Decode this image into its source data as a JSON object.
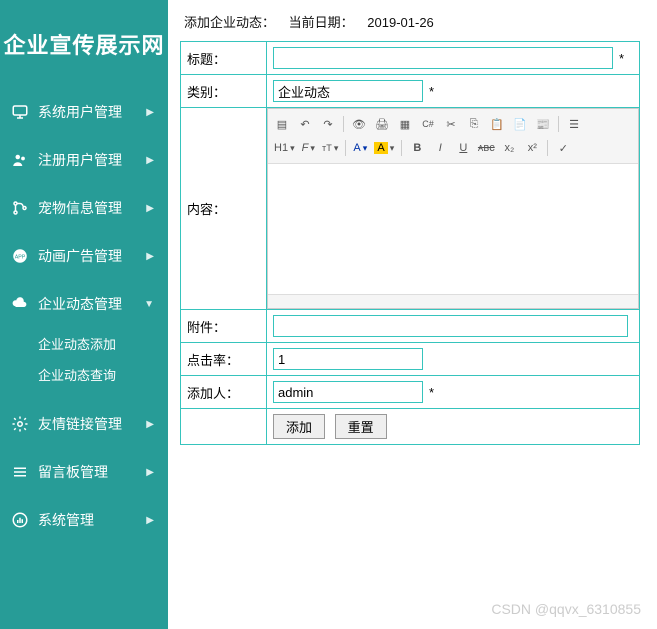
{
  "brand": "企业宣传展示网",
  "sidebar": {
    "items": [
      {
        "label": "系统用户管理",
        "expanded": false
      },
      {
        "label": "注册用户管理",
        "expanded": false
      },
      {
        "label": "宠物信息管理",
        "expanded": false
      },
      {
        "label": "动画广告管理",
        "expanded": false
      },
      {
        "label": "企业动态管理",
        "expanded": true,
        "children": [
          "企业动态添加",
          "企业动态查询"
        ]
      },
      {
        "label": "友情链接管理",
        "expanded": false
      },
      {
        "label": "留言板管理",
        "expanded": false
      },
      {
        "label": "系统管理",
        "expanded": false
      }
    ]
  },
  "crumb": {
    "title": "添加企业动态：",
    "date_label": "当前日期：",
    "date": "2019-01-26"
  },
  "form": {
    "title_label": "标题：",
    "title_value": "",
    "category_label": "类别：",
    "category_value": "企业动态",
    "content_label": "内容：",
    "attach_label": "附件：",
    "attach_value": "",
    "hits_label": "点击率：",
    "hits_value": "1",
    "adder_label": "添加人：",
    "adder_value": "admin",
    "asterisk": "*",
    "submit": "添加",
    "reset": "重置"
  },
  "watermark": "CSDN @qqvx_6310855"
}
